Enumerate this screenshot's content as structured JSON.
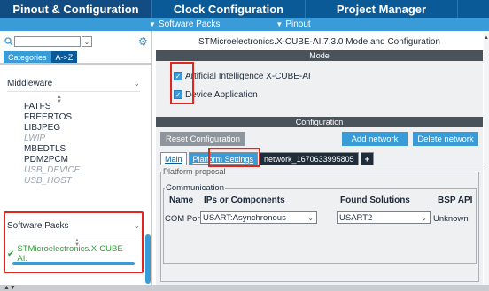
{
  "top_tabs": [
    {
      "label": "Pinout & Configuration"
    },
    {
      "label": "Clock Configuration"
    },
    {
      "label": "Project Manager"
    },
    {
      "label": ""
    }
  ],
  "sub_tabs": [
    {
      "label": "Software Packs"
    },
    {
      "label": "Pinout"
    }
  ],
  "left": {
    "category_tabs": [
      "Categories",
      "A->Z"
    ],
    "middleware_label": "Middleware",
    "middleware_items": [
      {
        "label": "FATFS",
        "enabled": true
      },
      {
        "label": "FREERTOS",
        "enabled": true
      },
      {
        "label": "LIBJPEG",
        "enabled": true
      },
      {
        "label": "LWIP",
        "enabled": false
      },
      {
        "label": "MBEDTLS",
        "enabled": true
      },
      {
        "label": "PDM2PCM",
        "enabled": true
      },
      {
        "label": "USB_DEVICE",
        "enabled": false
      },
      {
        "label": "USB_HOST",
        "enabled": false
      }
    ],
    "software_packs_label": "Software Packs",
    "software_pack_item": "STMicroelectronics.X-CUBE-AI.",
    "pack_progress": 1.0
  },
  "right": {
    "title": "STMicroelectronics.X-CUBE-AI.7.3.0 Mode and Configuration",
    "mode_label": "Mode",
    "mode_options": [
      {
        "label": "Artificial Intelligence X-CUBE-AI",
        "checked": true
      },
      {
        "label": "Device Application",
        "checked": true
      }
    ],
    "configuration_label": "Configuration",
    "buttons": {
      "reset": "Reset Configuration",
      "add_network": "Add network",
      "delete_network": "Delete network"
    },
    "tabs": [
      {
        "label": "Main"
      },
      {
        "label": "Platform Settings"
      },
      {
        "label": "network_1670633995805"
      },
      {
        "label": "+"
      }
    ],
    "platform_proposal_label": "Platform proposal",
    "communication_label": "Communication",
    "table_headers": [
      "Name",
      "IPs or Components",
      "Found Solutions",
      "BSP API"
    ],
    "table_row": {
      "name": "COM Port",
      "ip": "USART:Asynchronous",
      "solution": "USART2",
      "bsp": "Unknown"
    }
  },
  "colors": {
    "header_blue": "#0b5a98",
    "sub_blue": "#3a9bd9",
    "highlight_red": "#e0261d",
    "pack_green": "#2f9e3a"
  }
}
